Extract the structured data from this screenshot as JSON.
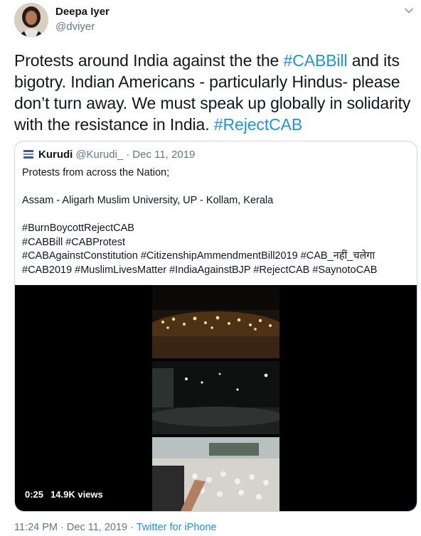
{
  "author": {
    "name": "Deepa Iyer",
    "handle": "@dviyer"
  },
  "tweet": {
    "segments": [
      {
        "text": "Protests around India against the the ",
        "tag": false
      },
      {
        "text": "#CABBill",
        "tag": true
      },
      {
        "text": " and its bigotry. Indian Americans  - particularly Hindus- please don’t turn away. We must speak up globally in solidarity with the resistance in India. ",
        "tag": false
      },
      {
        "text": "#RejectCAB",
        "tag": true
      }
    ]
  },
  "quoted": {
    "name": "Kurudi",
    "handle": "@Kurudi_",
    "separator": "·",
    "date": "Dec 11, 2019",
    "lines": [
      "Protests from across the Nation;",
      "",
      "Assam - Aligarh Muslim University, UP - Kollam, Kerala",
      "",
      "#BurnBoycottRejectCAB",
      "#CABBill #CABProtest",
      "#CABAgainstConstitution #CitizenshipAmmendmentBill2019 #CAB_नहीं_चलेगा",
      "#CAB2019 #MuslimLivesMatter #IndiaAgainstBJP #RejectCAB #SaynotoCAB"
    ],
    "video": {
      "duration": "0:25",
      "views": "14.9K views"
    }
  },
  "footer": {
    "time": "11:24 PM",
    "sep1": "·",
    "date": "Dec 11, 2019",
    "sep2": "·",
    "source": "Twitter for iPhone"
  },
  "colors": {
    "link": "#1b95e0",
    "muted": "#657786",
    "text": "#14171a",
    "border": "#ccd6dd"
  },
  "icons": {
    "chevron": "chevron-down-icon"
  }
}
